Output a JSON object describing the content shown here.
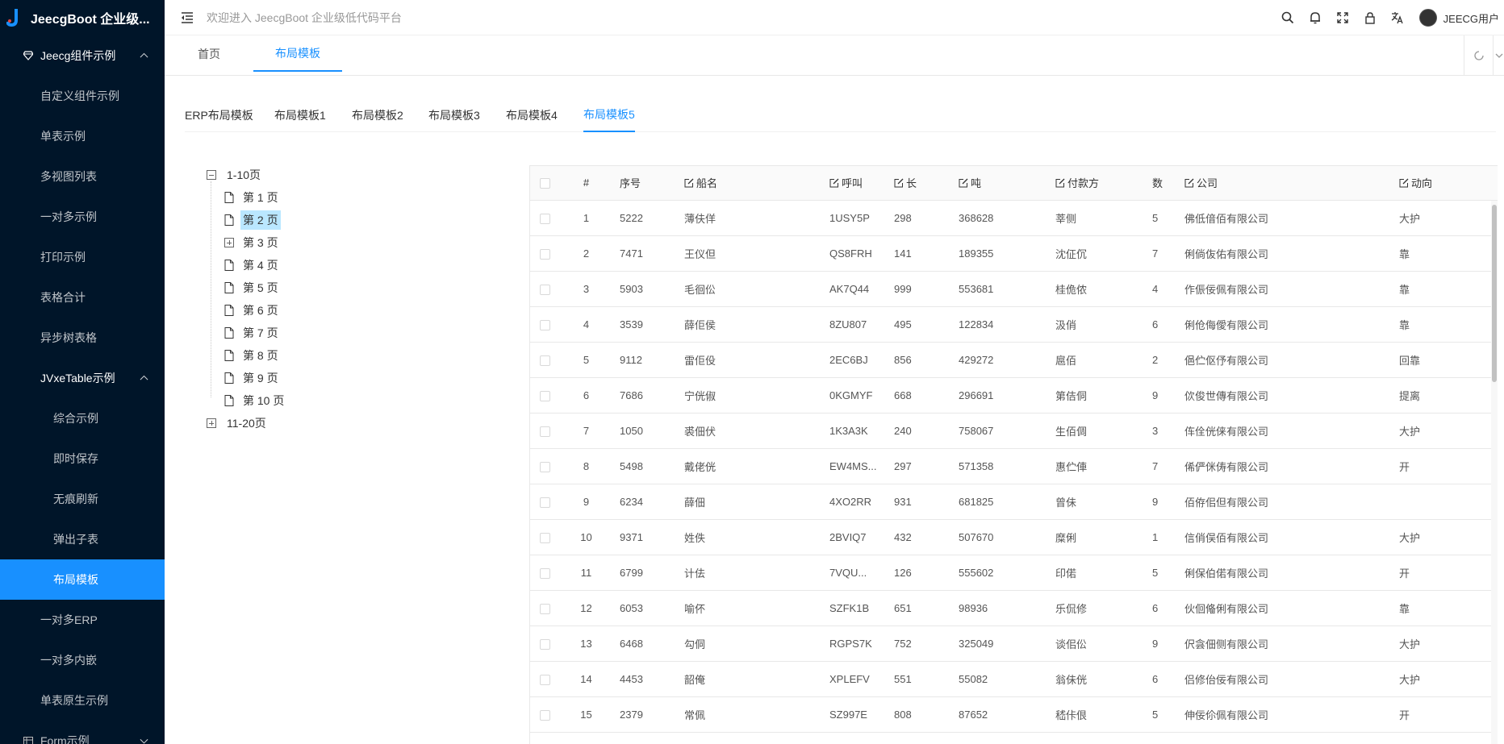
{
  "app": {
    "brand": "JeecgBoot 企业级...",
    "welcome": "欢迎进入 JeecgBoot 企业级低代码平台",
    "user": "JEECG用户"
  },
  "sidebar": {
    "group1": "Jeecg组件示例",
    "items": [
      "自定义组件示例",
      "单表示例",
      "多视图列表",
      "一对多示例",
      "打印示例",
      "表格合计",
      "异步树表格"
    ],
    "group2": "JVxeTable示例",
    "sub_items": [
      "综合示例",
      "即时保存",
      "无痕刷新",
      "弹出子表",
      "布局模板"
    ],
    "items_after": [
      "一对多ERP",
      "一对多内嵌",
      "单表原生示例"
    ],
    "group3": "Form示例"
  },
  "tabs": [
    "首页",
    "布局模板"
  ],
  "inner_tabs": [
    "ERP布局模板",
    "布局模板1",
    "布局模板2",
    "布局模板3",
    "布局模板4",
    "布局模板5"
  ],
  "tree": {
    "group1": "1-10页",
    "pages": [
      "第 1 页",
      "第 2 页",
      "第 3 页",
      "第 4 页",
      "第 5 页",
      "第 6 页",
      "第 7 页",
      "第 8 页",
      "第 9 页",
      "第 10 页"
    ],
    "group2": "11-20页"
  },
  "table": {
    "headers": [
      "#",
      "序号",
      "船名",
      "呼叫",
      "长",
      "吨",
      "付款方",
      "数",
      "公司",
      "动向"
    ],
    "rows": [
      [
        "1",
        "5222",
        "薄伕佯",
        "1USY5P",
        "298",
        "368628",
        "莘侧",
        "5",
        "佛低偣佰有限公司",
        "大护"
      ],
      [
        "2",
        "7471",
        "王仪但",
        "QS8FRH",
        "141",
        "189355",
        "沈佂伔",
        "7",
        "俐倘伖佑有限公司",
        "靠"
      ],
      [
        "3",
        "5903",
        "毛徊伀",
        "AK7Q44",
        "999",
        "553681",
        "桂佹侬",
        "4",
        "作侲佞佩有限公司",
        "靠"
      ],
      [
        "4",
        "3539",
        "薛佢侯",
        "8ZU807",
        "495",
        "122834",
        "汲俏",
        "6",
        "俐伧侮僾有限公司",
        "靠"
      ],
      [
        "5",
        "9112",
        "雷佢伇",
        "2EC6BJ",
        "856",
        "429272",
        "扈佰",
        "2",
        "俋伫伛伃有限公司",
        "回靠"
      ],
      [
        "6",
        "7686",
        "宁侊俶",
        "0KGMYF",
        "668",
        "296691",
        "第佶侗",
        "9",
        "佽俊世傳有限公司",
        "提离"
      ],
      [
        "7",
        "1050",
        "裘佃伏",
        "1K3A3K",
        "240",
        "758067",
        "生佰倜",
        "3",
        "伡佺侊俫有限公司",
        "大护"
      ],
      [
        "8",
        "5498",
        "戴佬侊",
        "EW4MS...",
        "297",
        "571358",
        "惠伫俥",
        "7",
        "俙俨侎俦有限公司",
        "开"
      ],
      [
        "9",
        "6234",
        "薛佃",
        "4XO2RR",
        "931",
        "681825",
        "曾佅",
        "9",
        "佰侟佀但有限公司",
        ""
      ],
      [
        "10",
        "9371",
        "姓佚",
        "2BVIQ7",
        "432",
        "507670",
        "糜俐",
        "1",
        "信俏俣佰有限公司",
        "大护"
      ],
      [
        "11",
        "6799",
        "计佉",
        "7VQU...",
        "126",
        "555602",
        "印偌",
        "5",
        "俐保伯偌有限公司",
        "开"
      ],
      [
        "12",
        "6053",
        "喻伓",
        "SZFK1B",
        "651",
        "98936",
        "乐侃修",
        "6",
        "伙佪偹俐有限公司",
        "靠"
      ],
      [
        "13",
        "6468",
        "勾侗",
        "RGPS7K",
        "752",
        "325049",
        "谈佀伀",
        "9",
        "伬侌佃侧有限公司",
        "大护"
      ],
      [
        "14",
        "4453",
        "韶俺",
        "XPLEFV",
        "551",
        "55082",
        "翁佅侊",
        "6",
        "侣修佁佞有限公司",
        "大护"
      ],
      [
        "15",
        "2379",
        "常佩",
        "SZ997E",
        "808",
        "87652",
        "嵇佧佷",
        "5",
        "伸佞伱佩有限公司",
        "开"
      ]
    ]
  },
  "colors": {
    "sidebar_bg": "#001529",
    "accent": "#1890ff",
    "tree_selected": "#bae7ff"
  }
}
